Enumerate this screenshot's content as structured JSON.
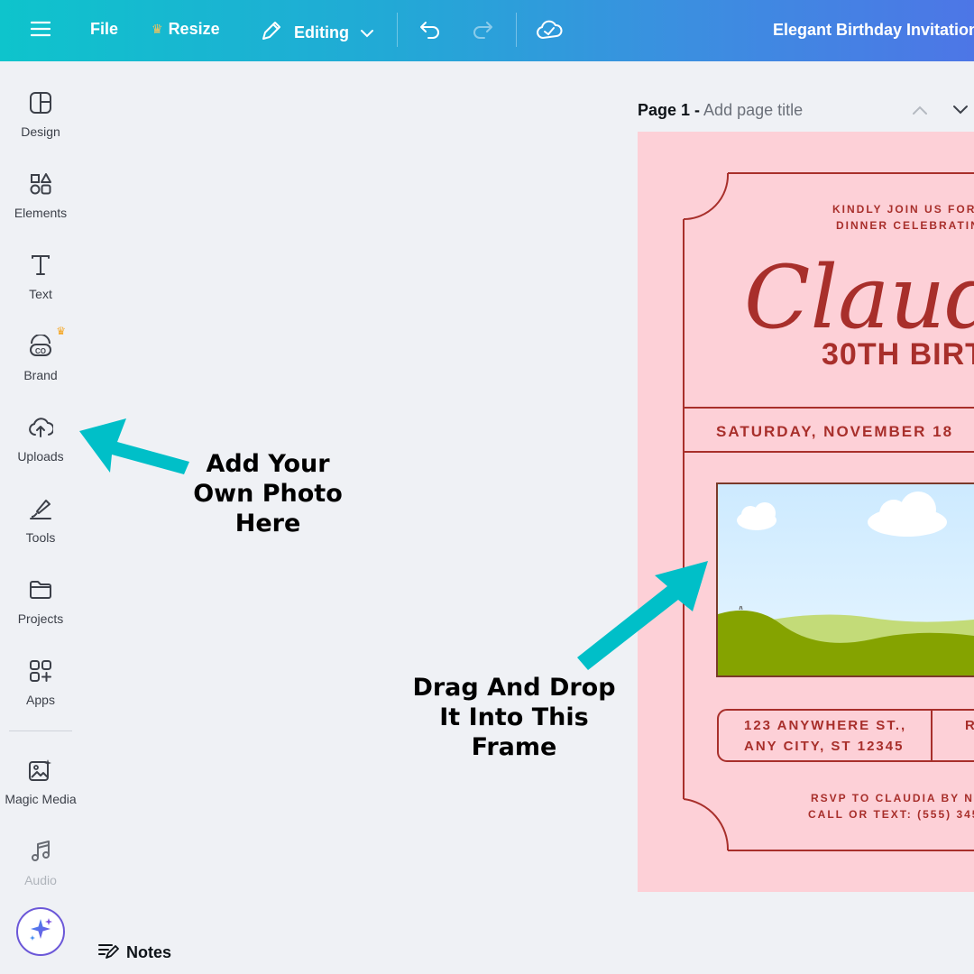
{
  "topbar": {
    "file": "File",
    "resize": "Resize",
    "editing": "Editing",
    "title": "Elegant Birthday Invitation"
  },
  "sidebar": {
    "items": [
      {
        "label": "Design",
        "icon": "design-icon"
      },
      {
        "label": "Elements",
        "icon": "elements-icon"
      },
      {
        "label": "Text",
        "icon": "text-icon"
      },
      {
        "label": "Brand",
        "icon": "brand-icon"
      },
      {
        "label": "Uploads",
        "icon": "uploads-icon"
      },
      {
        "label": "Tools",
        "icon": "tools-icon"
      },
      {
        "label": "Projects",
        "icon": "projects-icon"
      },
      {
        "label": "Apps",
        "icon": "apps-icon"
      },
      {
        "label": "Magic Media",
        "icon": "magic-media-icon"
      },
      {
        "label": "Audio",
        "icon": "audio-icon"
      }
    ]
  },
  "notes": "Notes",
  "page": {
    "number": "Page 1 -",
    "title_placeholder": "Add page title"
  },
  "invitation": {
    "line1": "KINDLY JOIN US FOR",
    "line2": "DINNER CELEBRATING",
    "name": "Claudi",
    "subtitle": "30TH BIRT",
    "date": "SATURDAY, NOVEMBER 18",
    "address1": "123 ANYWHERE ST.,",
    "address2": "ANY CITY, ST 12345",
    "rsvp_partial": "R",
    "rsvp1": "RSVP TO CLAUDIA BY NO",
    "rsvp2": "CALL OR TEXT: (555) 345"
  },
  "callouts": {
    "upload": [
      "Add Your",
      "Own Photo",
      "Here"
    ],
    "drag": [
      "Drag And Drop",
      "It Into This",
      "Frame"
    ]
  },
  "colors": {
    "topbar_start": "#0ec4cc",
    "topbar_end": "#4d76e6",
    "arrow": "#00bfc8",
    "invitation_bg": "#fdd0d7",
    "invitation_ink": "#a82f2b"
  }
}
